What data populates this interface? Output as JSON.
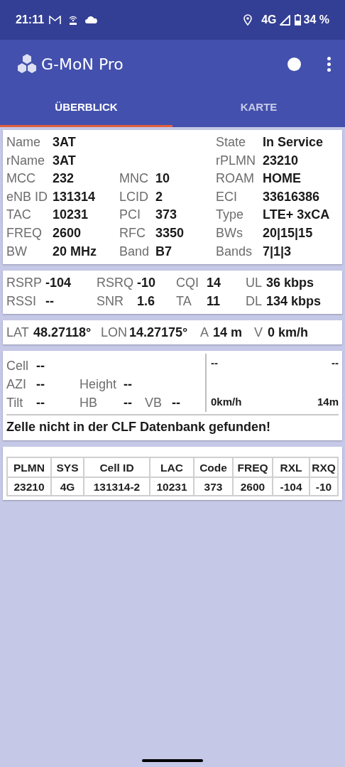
{
  "status_bar": {
    "time": "21:11",
    "network": "4G",
    "battery": "34 %"
  },
  "app_bar": {
    "title": "G-MoN Pro"
  },
  "tabs": [
    {
      "label": "ÜBERBLICK",
      "selected": true
    },
    {
      "label": "KARTE",
      "selected": false
    }
  ],
  "network_card": {
    "rows": [
      {
        "left": {
          "label": "Name",
          "value": "3AT"
        },
        "right": {
          "label": "State",
          "value": "In Service"
        }
      },
      {
        "left": {
          "label": "rName",
          "value": "3AT"
        },
        "right": {
          "label": "rPLMN",
          "value": "23210"
        }
      },
      {
        "left": {
          "label": "MCC",
          "value": "232"
        },
        "middle": {
          "label": "MNC",
          "value": "10"
        },
        "right": {
          "label": "ROAM",
          "value": "HOME"
        }
      },
      {
        "left": {
          "label": "eNB ID",
          "value": "131314"
        },
        "middle": {
          "label": "LCID",
          "value": "2"
        },
        "right": {
          "label": "ECI",
          "value": "33616386"
        }
      },
      {
        "left": {
          "label": "TAC",
          "value": "10231"
        },
        "middle": {
          "label": "PCI",
          "value": "373"
        },
        "right": {
          "label": "Type",
          "value": "LTE+ 3xCA"
        }
      },
      {
        "left": {
          "label": "FREQ",
          "value": "2600"
        },
        "middle": {
          "label": "RFC",
          "value": "3350"
        },
        "right": {
          "label": "BWs",
          "value": "20|15|15"
        }
      },
      {
        "left": {
          "label": "BW",
          "value": "20 MHz"
        },
        "middle": {
          "label": "Band",
          "value": "B7"
        },
        "right": {
          "label": "Bands",
          "value": "7|1|3"
        }
      }
    ]
  },
  "signal_card": {
    "rows": [
      [
        {
          "label": "RSRP",
          "value": "-104"
        },
        {
          "label": "RSRQ",
          "value": "-10"
        },
        {
          "label": "CQI",
          "value": "14"
        },
        {
          "label": "UL",
          "value": "36 kbps"
        }
      ],
      [
        {
          "label": "RSSI",
          "value": "--"
        },
        {
          "label": "SNR",
          "value": "1.6"
        },
        {
          "label": "TA",
          "value": "11"
        },
        {
          "label": "DL",
          "value": "134 kbps"
        }
      ]
    ]
  },
  "location_card": {
    "fields": [
      {
        "label": "LAT",
        "value": "48.27118°"
      },
      {
        "label": "LON",
        "value": "14.27175°"
      },
      {
        "label": "A",
        "value": "14 m"
      },
      {
        "label": "V",
        "value": "0 km/h"
      }
    ]
  },
  "cell_card": {
    "rows": [
      [
        {
          "label": "Cell",
          "value": "--"
        }
      ],
      [
        {
          "label": "AZI",
          "value": "--"
        },
        {
          "label": "Height",
          "value": "--"
        }
      ],
      [
        {
          "label": "Tilt",
          "value": "--"
        },
        {
          "label": "HB",
          "value": "--"
        },
        {
          "label": "VB",
          "value": "--"
        }
      ]
    ],
    "panel": {
      "top_left": "--",
      "top_right": "--",
      "bottom_left": "0km/h",
      "bottom_right": "14m"
    },
    "message": "Zelle nicht in der CLF Datenbank gefunden!"
  },
  "cell_table": {
    "columns": [
      "PLMN",
      "SYS",
      "Cell ID",
      "LAC",
      "Code",
      "FREQ",
      "RXL",
      "RXQ"
    ],
    "rows": [
      [
        "23210",
        "4G",
        "131314-2",
        "10231",
        "373",
        "2600",
        "-104",
        "-10"
      ]
    ]
  }
}
